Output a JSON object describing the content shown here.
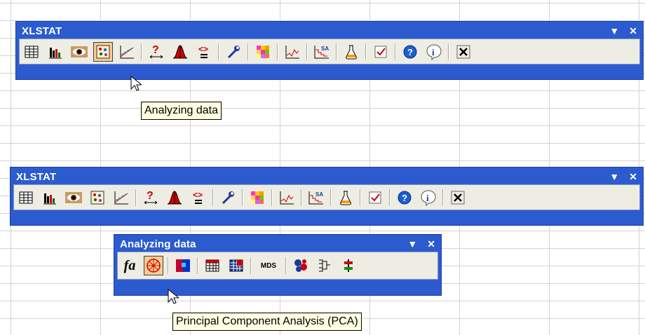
{
  "toolbar_main": {
    "title": "XLSTAT",
    "dropdown_glyph": "▼",
    "close_glyph": "✕",
    "icons": [
      "data-table-icon",
      "bar-chart-icon",
      "eye-icon",
      "analyzing-data-icon",
      "regression-icon",
      "test-icon",
      "normal-distribution-icon",
      "comparison-icon",
      "tools-icon",
      "color-grid-icon",
      "time-series-icon",
      "survival-analysis-icon",
      "flask-icon",
      "checkbox-icon",
      "help-icon",
      "about-icon",
      "close-box-icon"
    ]
  },
  "tooltip1": {
    "text": "Analyzing data"
  },
  "toolbar_sub": {
    "title": "Analyzing data",
    "dropdown_glyph": "▼",
    "close_glyph": "✕",
    "fa_label": "fa",
    "mds_label": "MDS"
  },
  "tooltip2": {
    "text": "Principal Component Analysis (PCA)"
  }
}
